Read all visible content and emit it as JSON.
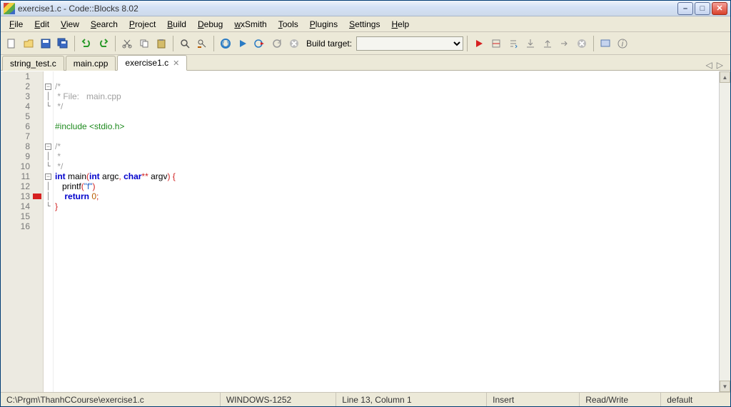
{
  "title": "exercise1.c - Code::Blocks 8.02",
  "menus": [
    "File",
    "Edit",
    "View",
    "Search",
    "Project",
    "Build",
    "Debug",
    "wxSmith",
    "Tools",
    "Plugins",
    "Settings",
    "Help"
  ],
  "toolbar": {
    "build_target_label": "Build target:"
  },
  "tabs": [
    {
      "label": "string_test.c",
      "active": false
    },
    {
      "label": "main.cpp",
      "active": false
    },
    {
      "label": "exercise1.c",
      "active": true
    }
  ],
  "code": {
    "lines": [
      {
        "n": 1,
        "fold": "",
        "html": ""
      },
      {
        "n": 2,
        "fold": "-",
        "html": "<span class='c-comment'>/*</span>"
      },
      {
        "n": 3,
        "fold": "|",
        "html": "<span class='c-comment'> * File:   main.cpp</span>"
      },
      {
        "n": 4,
        "fold": "L",
        "html": "<span class='c-comment'> */</span>"
      },
      {
        "n": 5,
        "fold": "",
        "html": ""
      },
      {
        "n": 6,
        "fold": "",
        "html": "<span class='c-pre'>#include &lt;stdio.h&gt;</span>"
      },
      {
        "n": 7,
        "fold": "",
        "html": ""
      },
      {
        "n": 8,
        "fold": "-",
        "html": "<span class='c-comment'>/*</span>"
      },
      {
        "n": 9,
        "fold": "|",
        "html": "<span class='c-comment'> *</span>"
      },
      {
        "n": 10,
        "fold": "L",
        "html": "<span class='c-comment'> */</span>"
      },
      {
        "n": 11,
        "fold": "-",
        "html": "<span class='c-kw'>int</span> main<span class='c-punc'>(</span><span class='c-kw'>int</span> argc<span class='c-punc'>,</span> <span class='c-kw'>char</span><span class='c-punc'>**</span> argv<span class='c-punc'>)</span> <span class='c-punc'>{</span>"
      },
      {
        "n": 12,
        "fold": "|",
        "html": "   printf<span class='c-punc'>(</span><span class='c-str'>\"f\"</span><span class='c-punc'>)</span>"
      },
      {
        "n": 13,
        "fold": "|",
        "mark": true,
        "html": "    <span class='c-kw'>return</span> <span class='c-num'>0</span><span class='c-punc'>;</span>"
      },
      {
        "n": 14,
        "fold": "L",
        "html": "<span class='c-punc'>}</span>"
      },
      {
        "n": 15,
        "fold": "",
        "html": ""
      },
      {
        "n": 16,
        "fold": "",
        "html": ""
      }
    ]
  },
  "status": {
    "path": "C:\\Prgm\\ThanhCCourse\\exercise1.c",
    "encoding": "WINDOWS-1252",
    "position": "Line 13, Column 1",
    "insert": "Insert",
    "rw": "Read/Write",
    "modified": "default"
  }
}
